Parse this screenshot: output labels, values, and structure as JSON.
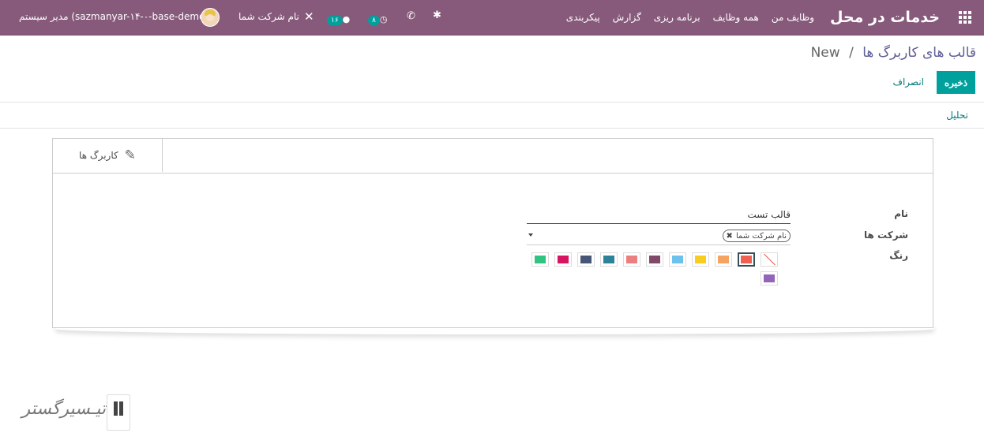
{
  "navbar": {
    "brand": "خدمات در محل",
    "menu": [
      "وظایف من",
      "همه وظایف",
      "برنامه ریزی",
      "گزارش",
      "پیکربندی"
    ],
    "company": "نام شرکت شما",
    "messages_badge": "۱۶",
    "activities_badge": "۸",
    "user": "مدیر سیستم (sazmanyar-۱۴-۰-base-demo)",
    "icons": [
      "apps-icon",
      "bug-icon",
      "phone-icon",
      "clock-icon",
      "chat-icon",
      "tools-icon",
      "avatar"
    ]
  },
  "breadcrumb": {
    "parent": "قالب های کاربرگ ها",
    "separator": "/",
    "current": "New"
  },
  "buttons": {
    "save": "ذخیره",
    "discard": "انصراف"
  },
  "actions": {
    "analysis": "تحلیل"
  },
  "sheet": {
    "smart_button": "کاربرگ ها",
    "fields": {
      "name_label": "نام",
      "name_value": "قالب تست",
      "companies_label": "شرکت ها",
      "companies_tag": "نام شرکت شما",
      "color_label": "رنگ"
    },
    "colors": [
      "none",
      "#f06050",
      "#f4a460",
      "#f7cd1f",
      "#6cc1ed",
      "#814968",
      "#eb7e7f",
      "#2c8397",
      "#475577",
      "#d6145f",
      "#30c381",
      "#9365b8"
    ],
    "selected_color": "#f06050"
  },
  "watermark": "تیـسیرگستر"
}
